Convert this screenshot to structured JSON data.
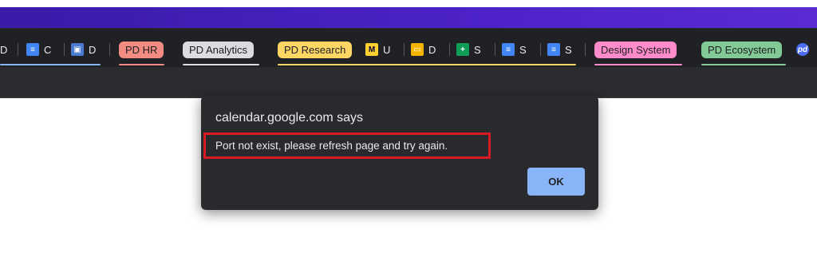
{
  "tabs": [
    {
      "label": "D",
      "icon": "docs-icon"
    },
    {
      "label": "C",
      "icon": "docs-icon"
    },
    {
      "label": "D",
      "icon": "doc-image-icon"
    },
    {
      "label": "U",
      "icon": "miro-icon"
    },
    {
      "label": "D",
      "icon": "slides-icon"
    },
    {
      "label": "S",
      "icon": "sheets-icon"
    },
    {
      "label": "S",
      "icon": "docs-icon"
    },
    {
      "label": "S",
      "icon": "docs-icon"
    }
  ],
  "tab_groups": [
    {
      "label": "PD HR",
      "color": "#f28b82"
    },
    {
      "label": "PD Analytics",
      "color": "#dadce0"
    },
    {
      "label": "PD Research",
      "color": "#fdd663"
    },
    {
      "label": "Design System",
      "color": "#ff8bcb"
    },
    {
      "label": "PD Ecosystem",
      "color": "#81c995"
    }
  ],
  "last_tab_icon": "pd-app-icon",
  "dialog": {
    "title": "calendar.google.com says",
    "message": "Port not exist, please refresh page and try again.",
    "ok_label": "OK"
  },
  "colors": {
    "titlebar": "#4d23c9",
    "tabstrip": "#202124",
    "dialog_bg": "#292a2d",
    "button": "#8ab4f8",
    "highlight": "#d81b22"
  }
}
